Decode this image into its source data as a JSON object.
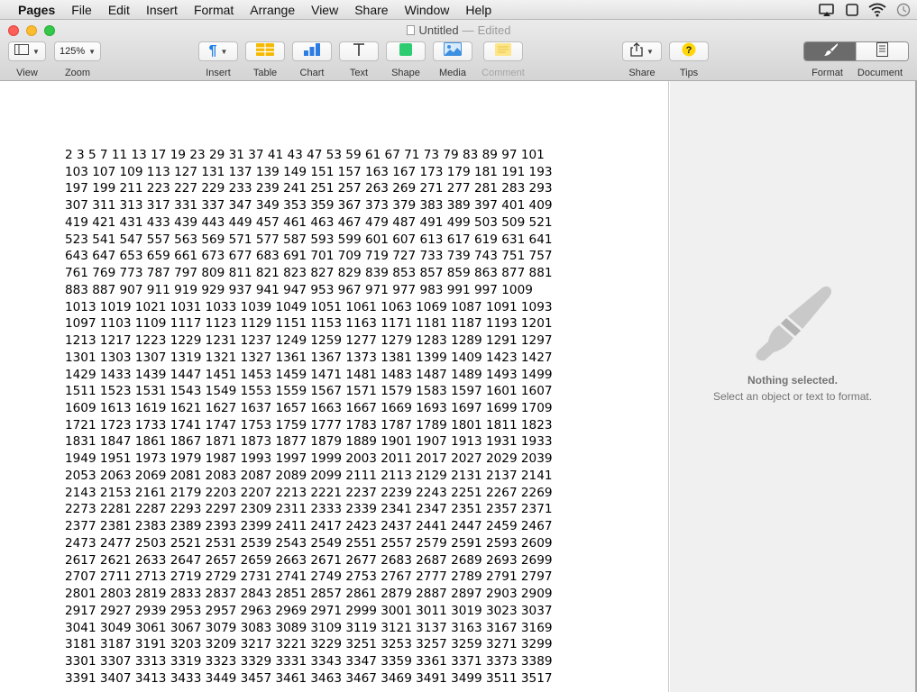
{
  "menubar": {
    "app": "Pages",
    "items": [
      "File",
      "Edit",
      "Insert",
      "Format",
      "Arrange",
      "View",
      "Share",
      "Window",
      "Help"
    ]
  },
  "window": {
    "title": "Untitled",
    "separator": "—",
    "status": "Edited"
  },
  "toolbar": {
    "view_label": "View",
    "zoom_label": "Zoom",
    "zoom_value": "125%",
    "insert_label": "Insert",
    "table_label": "Table",
    "chart_label": "Chart",
    "text_label": "Text",
    "shape_label": "Shape",
    "media_label": "Media",
    "comment_label": "Comment",
    "share_label": "Share",
    "tips_label": "Tips",
    "format_label": "Format",
    "document_label": "Document"
  },
  "inspector": {
    "title": "Nothing selected.",
    "hint": "Select an object or text to format."
  },
  "document": {
    "lines": [
      "2 3 5 7 11 13 17 19 23 29 31 37 41 43 47 53 59 61 67 71 73 79 83 89 97 101",
      "103 107 109 113 127 131 137 139 149 151 157 163 167 173 179 181 191 193",
      "197 199 211 223 227 229 233 239 241 251 257 263 269 271 277 281 283 293",
      "307 311 313 317 331 337 347 349 353 359 367 373 379 383 389 397 401 409",
      "419 421 431 433 439 443 449 457 461 463 467 479 487 491 499 503 509 521",
      "523 541 547 557 563 569 571 577 587 593 599 601 607 613 617 619 631 641",
      "643 647 653 659 661 673 677 683 691 701 709 719 727 733 739 743 751 757",
      "761 769 773 787 797 809 811 821 823 827 829 839 853 857 859 863 877 881",
      "883 887 907 911 919 929 937 941 947 953 967 971 977 983 991 997 1009",
      "1013 1019 1021 1031 1033 1039 1049 1051 1061 1063 1069 1087 1091 1093",
      "1097 1103 1109 1117 1123 1129 1151 1153 1163 1171 1181 1187 1193 1201",
      "1213 1217 1223 1229 1231 1237 1249 1259 1277 1279 1283 1289 1291 1297",
      "1301 1303 1307 1319 1321 1327 1361 1367 1373 1381 1399 1409 1423 1427",
      "1429 1433 1439 1447 1451 1453 1459 1471 1481 1483 1487 1489 1493 1499",
      "1511 1523 1531 1543 1549 1553 1559 1567 1571 1579 1583 1597 1601 1607",
      "1609 1613 1619 1621 1627 1637 1657 1663 1667 1669 1693 1697 1699 1709",
      "1721 1723 1733 1741 1747 1753 1759 1777 1783 1787 1789 1801 1811 1823",
      "1831 1847 1861 1867 1871 1873 1877 1879 1889 1901 1907 1913 1931 1933",
      "1949 1951 1973 1979 1987 1993 1997 1999 2003 2011 2017 2027 2029 2039",
      "2053 2063 2069 2081 2083 2087 2089 2099 2111 2113 2129 2131 2137 2141",
      "2143 2153 2161 2179 2203 2207 2213 2221 2237 2239 2243 2251 2267 2269",
      "2273 2281 2287 2293 2297 2309 2311 2333 2339 2341 2347 2351 2357 2371",
      "2377 2381 2383 2389 2393 2399 2411 2417 2423 2437 2441 2447 2459 2467",
      "2473 2477 2503 2521 2531 2539 2543 2549 2551 2557 2579 2591 2593 2609",
      "2617 2621 2633 2647 2657 2659 2663 2671 2677 2683 2687 2689 2693 2699",
      "2707 2711 2713 2719 2729 2731 2741 2749 2753 2767 2777 2789 2791 2797",
      "2801 2803 2819 2833 2837 2843 2851 2857 2861 2879 2887 2897 2903 2909",
      "2917 2927 2939 2953 2957 2963 2969 2971 2999 3001 3011 3019 3023 3037",
      "3041 3049 3061 3067 3079 3083 3089 3109 3119 3121 3137 3163 3167 3169",
      "3181 3187 3191 3203 3209 3217 3221 3229 3251 3253 3257 3259 3271 3299",
      "3301 3307 3313 3319 3323 3329 3331 3343 3347 3359 3361 3371 3373 3389",
      "3391 3407 3413 3433 3449 3457 3461 3463 3467 3469 3491 3499 3511 3517"
    ]
  },
  "colors": {
    "close": "#fc5f57",
    "minimize": "#fdbc2e",
    "maximize": "#34c84a",
    "table_icon": "#f5b900",
    "chart_icon": "#2b7de1",
    "shape_icon": "#2ecc71",
    "media_icon": "#3d8fe0",
    "tips_icon": "#ffd60a"
  },
  "icons": {
    "view": "sidebar-icon",
    "insert": "pilcrow-icon",
    "table": "table-icon",
    "chart": "bar-chart-icon",
    "text": "text-icon",
    "shape": "shape-icon",
    "media": "image-icon",
    "comment": "comment-icon",
    "share": "share-icon",
    "tips": "question-icon",
    "format": "paintbrush-icon",
    "document": "document-icon",
    "inspector_empty": "paintbrush-icon"
  }
}
